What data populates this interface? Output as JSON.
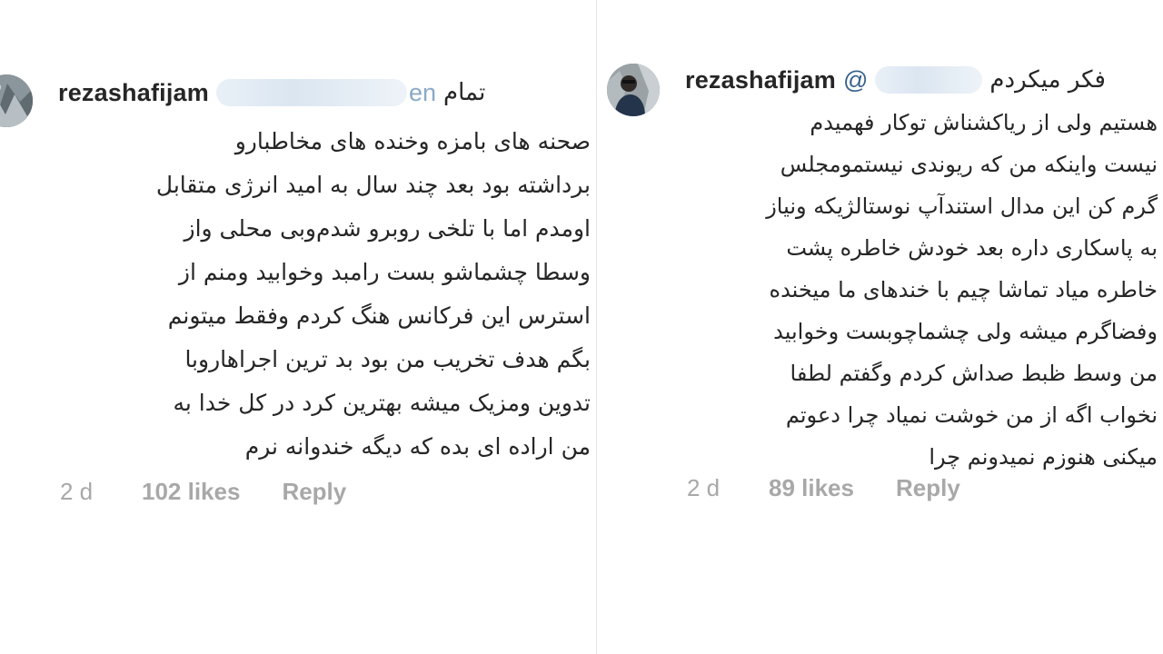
{
  "comments": [
    {
      "username": "rezashafijam",
      "mention_tail": "en",
      "header_word": "تمام",
      "lines": [
        "صحنه های بامزه وخنده های مخاطبارو",
        "برداشته بود بعد چند سال به امید انرژی متقابل",
        "اومدم اما با تلخی روبرو شدم‌وبی محلی واز",
        "وسطا چشماشو بست رامبد وخوابید ومنم از",
        "استرس این فرکانس هنگ کردم وفقط میتونم",
        "بگم هدف تخریب  من بود بد ترین اجراهاروبا",
        "تدوین ومزیک میشه بهترین کرد در کل خدا به",
        "من اراده ای بده که دیگه خندوانه نرم"
      ],
      "time": "2 d",
      "likes": "102 likes",
      "reply": "Reply"
    },
    {
      "username": "rezashafijam",
      "mention_at": "@",
      "header_word": "فکر میکردم",
      "lines": [
        "هستیم  ولی از ریاکشناش توکار فهمیدم",
        "نیست واینکه من که ریوندی نیستمومجلس",
        "گرم کن این مدال استندآپ نوستالژیکه ونیاز",
        "به پاسکاری داره بعد خودش خاطره پشت",
        "خاطره میاد تماشا چیم با خندهای ما میخنده",
        "وفضاگرم میشه ولی چشماچوبست وخوابید",
        "من وسط ظبط صداش کردم وگفتم لطفا",
        "نخواب اگه از من خوشت نمیاد چرا دعوتم",
        "میکنی هنوزم نمیدونم چرا"
      ],
      "time": "2 d",
      "likes": "89 likes",
      "reply": "Reply"
    }
  ]
}
